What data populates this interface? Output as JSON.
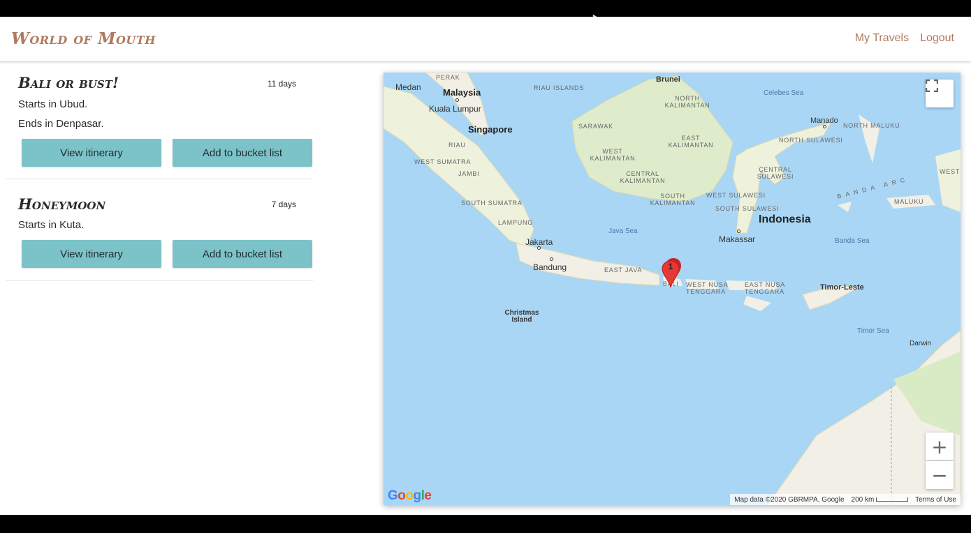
{
  "app": {
    "brand": "World of Mouth",
    "nav": {
      "my_travels": "My Travels",
      "logout": "Logout"
    }
  },
  "trips": [
    {
      "title": "Bali or bust!",
      "days": "11 days",
      "start": "Starts in Ubud.",
      "end": "Ends in Denpasar.",
      "view_label": "View itinerary",
      "bucket_label": "Add to bucket list"
    },
    {
      "title": "Honeymoon",
      "days": "7 days",
      "start": "Starts in Kuta.",
      "view_label": "View itinerary",
      "bucket_label": "Add to bucket list"
    }
  ],
  "map": {
    "labels": {
      "medan": "Medan",
      "perak": "PERAK",
      "malaysia": "Malaysia",
      "kuala_lumpur": "Kuala Lumpur",
      "riau_islands": "RIAU ISLANDS",
      "singapore": "Singapore",
      "riau": "RIAU",
      "west_sumatra": "WEST SUMATRA",
      "jambi": "JAMBI",
      "south_sumatra": "SOUTH SUMATRA",
      "lampung": "LAMPUNG",
      "jakarta": "Jakarta",
      "bandung": "Bandung",
      "east_java": "EAST JAVA",
      "bali": "BALI",
      "west_nusa_tenggara": "WEST NUSA TENGGARA",
      "east_nusa_tenggara": "EAST NUSA TENGGARA",
      "timor_leste": "Timor-Leste",
      "christmas_island": "Christmas Island",
      "java_sea": "Java Sea",
      "brunei": "Brunei",
      "north_kalimantan": "NORTH KALIMANTAN",
      "sarawak": "SARAWAK",
      "east_kalimantan": "EAST KALIMANTAN",
      "west_kalimantan": "WEST KALIMANTAN",
      "central_kalimantan": "CENTRAL KALIMANTAN",
      "south_kalimantan": "SOUTH KALIMANTAN",
      "celebes_sea": "Celebes Sea",
      "manado": "Manado",
      "north_maluku": "NORTH MALUKU",
      "north_sulawesi": "NORTH SULAWESI",
      "central_sulawesi": "CENTRAL SULAWESI",
      "west_sulawesi": "WEST SULAWESI",
      "south_sulawesi": "SOUTH SULAWESI",
      "indonesia": "Indonesia",
      "makassar": "Makassar",
      "banda_arc": "BANDA ARC",
      "maluku": "MALUKU",
      "banda_sea": "Banda Sea",
      "timor_sea": "Timor Sea",
      "darwin": "Darwin",
      "west_p": "WEST P"
    },
    "marker_count": "1",
    "zoom_in": "+",
    "zoom_out": "−",
    "google": "Google",
    "attribution": "Map data ©2020 GBRMPA, Google",
    "scale": "200 km",
    "terms": "Terms of Use",
    "colors": {
      "water": "#a9d6f5",
      "land": "#f1efe6",
      "green": "#d9ebc4",
      "marker": "#e53935"
    }
  }
}
